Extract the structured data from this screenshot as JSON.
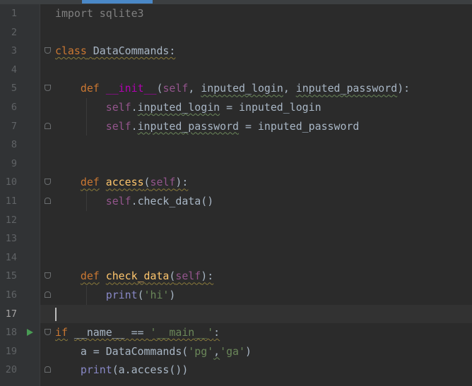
{
  "editor": {
    "language": "python",
    "current_line": 17,
    "lines": [
      {
        "number": "1",
        "text": "import sqlite3"
      },
      {
        "number": "2",
        "text": ""
      },
      {
        "number": "3",
        "text": "class DataCommands:"
      },
      {
        "number": "4",
        "text": ""
      },
      {
        "number": "5",
        "text": "    def __init__(self, inputed_login, inputed_password):"
      },
      {
        "number": "6",
        "text": "        self.inputed_login = inputed_login"
      },
      {
        "number": "7",
        "text": "        self.inputed_password = inputed_password"
      },
      {
        "number": "8",
        "text": ""
      },
      {
        "number": "9",
        "text": ""
      },
      {
        "number": "10",
        "text": "    def access(self):"
      },
      {
        "number": "11",
        "text": "        self.check_data()"
      },
      {
        "number": "12",
        "text": ""
      },
      {
        "number": "13",
        "text": ""
      },
      {
        "number": "14",
        "text": ""
      },
      {
        "number": "15",
        "text": "    def check_data(self):"
      },
      {
        "number": "16",
        "text": "        print('hi')"
      },
      {
        "number": "17",
        "text": ""
      },
      {
        "number": "18",
        "text": "if __name__ == '__main__':"
      },
      {
        "number": "19",
        "text": "    a = DataCommands('pg','ga')"
      },
      {
        "number": "20",
        "text": "    print(a.access())"
      }
    ]
  },
  "colors": {
    "background": "#2b2b2b",
    "gutter": "#313335",
    "keyword": "#cc7832",
    "self": "#94558d",
    "function": "#ffc66d",
    "string": "#6a8759",
    "builtin": "#8888c6",
    "run_icon": "#499c54"
  },
  "icons": {
    "fold": "fold-marker-icon",
    "run": "run-gutter-icon"
  }
}
